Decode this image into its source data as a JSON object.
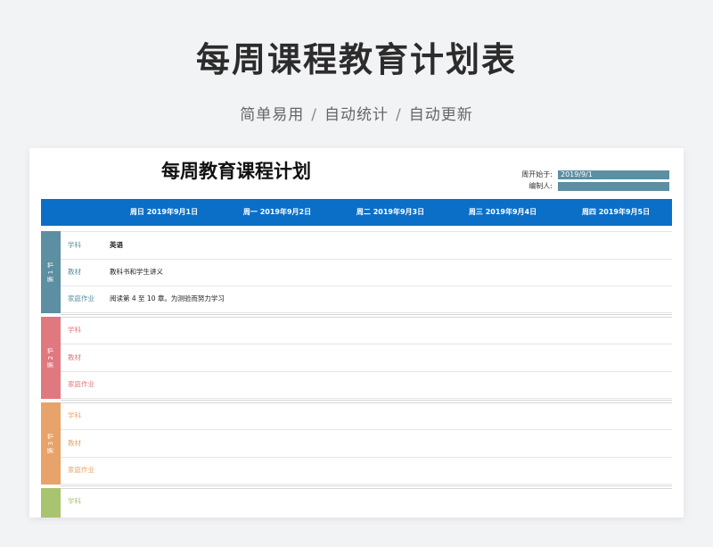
{
  "hero": {
    "title": "每周课程教育计划表",
    "features": [
      "简单易用",
      "自动统计",
      "自动更新"
    ],
    "separator": "/"
  },
  "sheet": {
    "title": "每周教育课程计划",
    "week_start_label": "周开始于:",
    "week_start_value": "2019/9/1",
    "editor_label": "编制人:",
    "editor_value": ""
  },
  "days": [
    "周日 2019年9月1日",
    "周一 2019年9月2日",
    "周二 2019年9月3日",
    "周三 2019年9月4日",
    "周四 2019年9月5日"
  ],
  "colors": {
    "header": "#0b6fc7",
    "period1": "#5b8fa1",
    "period2": "#e07880",
    "period3": "#e8a36a",
    "period4": "#a8c46f"
  },
  "periods": [
    {
      "label": "第 1 节",
      "rows": [
        {
          "label": "学科",
          "value": "英语"
        },
        {
          "label": "教材",
          "value": "教科书和学生讲义"
        },
        {
          "label": "家庭作业",
          "value": "阅读第 4 至 10 章。为测验而努力学习"
        }
      ]
    },
    {
      "label": "第 2 节",
      "rows": [
        {
          "label": "学科",
          "value": ""
        },
        {
          "label": "教材",
          "value": ""
        },
        {
          "label": "家庭作业",
          "value": ""
        }
      ]
    },
    {
      "label": "第 3 节",
      "rows": [
        {
          "label": "学科",
          "value": ""
        },
        {
          "label": "教材",
          "value": ""
        },
        {
          "label": "家庭作业",
          "value": ""
        }
      ]
    },
    {
      "label": "",
      "rows": [
        {
          "label": "学科",
          "value": ""
        }
      ]
    }
  ]
}
